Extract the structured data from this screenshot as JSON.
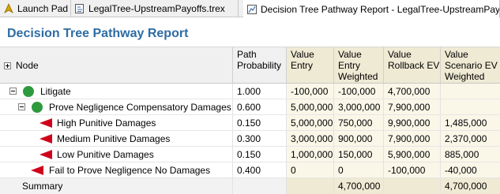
{
  "tabs": [
    {
      "label": "Launch Pad",
      "icon": "launch-pad-icon"
    },
    {
      "label": "LegalTree-UpstreamPayoffs.trex",
      "icon": "tree-file-icon"
    },
    {
      "label": "Decision Tree Pathway Report - LegalTree-UpstreamPayof",
      "icon": "report-icon"
    }
  ],
  "report": {
    "title": "Decision Tree Pathway Report",
    "columns": {
      "node": "Node",
      "path_probability": "Path\nProbability",
      "value_entry": "Value\nEntry",
      "value_entry_weighted": "Value\nEntry\nWeighted",
      "value_rollback_ev": "Value\nRollback EV",
      "value_scenario_ev_weighted": "Value\nScenario EV\nWeighted"
    },
    "rows": [
      {
        "node": "Litigate",
        "type": "chance",
        "indent": 0,
        "expander": true,
        "path_probability": "1.000",
        "value_entry": "-100,000",
        "value_entry_weighted": "-100,000",
        "value_rollback_ev": "4,700,000",
        "value_scenario_ev_weighted": ""
      },
      {
        "node": "Prove Negligence Compensatory Damages",
        "type": "chance",
        "indent": 1,
        "expander": true,
        "path_probability": "0.600",
        "value_entry": "5,000,000",
        "value_entry_weighted": "3,000,000",
        "value_rollback_ev": "7,900,000",
        "value_scenario_ev_weighted": ""
      },
      {
        "node": "High Punitive Damages",
        "type": "terminal",
        "indent": 2,
        "expander": false,
        "path_probability": "0.150",
        "value_entry": "5,000,000",
        "value_entry_weighted": "750,000",
        "value_rollback_ev": "9,900,000",
        "value_scenario_ev_weighted": "1,485,000"
      },
      {
        "node": "Medium Punitive Damages",
        "type": "terminal",
        "indent": 2,
        "expander": false,
        "path_probability": "0.300",
        "value_entry": "3,000,000",
        "value_entry_weighted": "900,000",
        "value_rollback_ev": "7,900,000",
        "value_scenario_ev_weighted": "2,370,000"
      },
      {
        "node": "Low Punitive Damages",
        "type": "terminal",
        "indent": 2,
        "expander": false,
        "path_probability": "0.150",
        "value_entry": "1,000,000",
        "value_entry_weighted": "150,000",
        "value_rollback_ev": "5,900,000",
        "value_scenario_ev_weighted": "885,000"
      },
      {
        "node": "Fail to Prove Negligence No Damages",
        "type": "terminal",
        "indent": 1,
        "expander": false,
        "path_probability": "0.400",
        "value_entry": "0",
        "value_entry_weighted": "0",
        "value_rollback_ev": "-100,000",
        "value_scenario_ev_weighted": "-40,000"
      }
    ],
    "summary": {
      "label": "Summary",
      "path_probability": "",
      "value_entry": "",
      "value_entry_weighted": "4,700,000",
      "value_rollback_ev": "",
      "value_scenario_ev_weighted": "4,700,000"
    }
  },
  "colors": {
    "title": "#2e6ca4",
    "chance_node": "#2e9a3e",
    "terminal_node": "#d0021b",
    "value_header_bg": "#efead4"
  }
}
